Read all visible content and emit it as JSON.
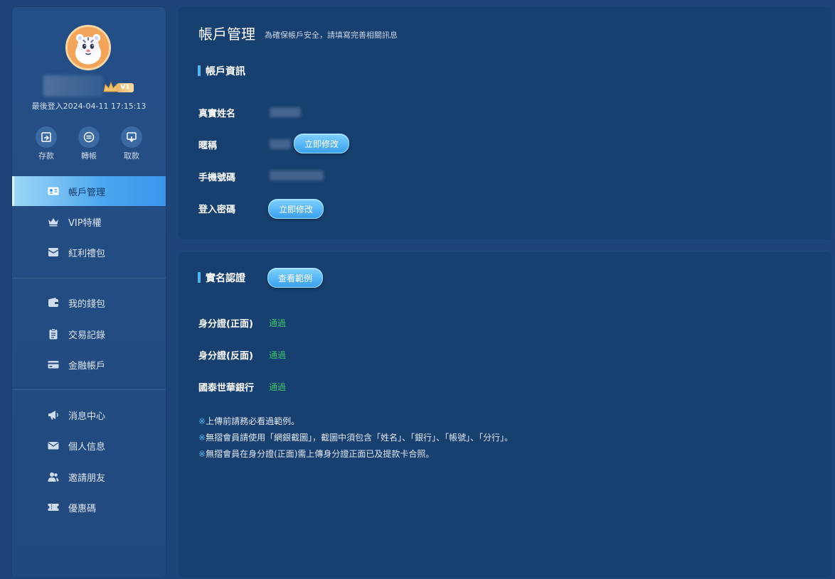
{
  "profile": {
    "last_login_label": "最後登入2024-04-11 17:15:13",
    "vip_level": "V1"
  },
  "quick_actions": [
    {
      "label": "存款",
      "icon": "deposit-icon"
    },
    {
      "label": "轉帳",
      "icon": "transfer-icon"
    },
    {
      "label": "取款",
      "icon": "withdraw-icon"
    }
  ],
  "nav": {
    "group1": [
      {
        "label": "帳戶管理",
        "icon": "id-card-icon",
        "active": true
      },
      {
        "label": "VIP特權",
        "icon": "crown-icon"
      },
      {
        "label": "紅利禮包",
        "icon": "envelope-gift-icon"
      }
    ],
    "group2": [
      {
        "label": "我的錢包",
        "icon": "wallet-icon"
      },
      {
        "label": "交易記錄",
        "icon": "clipboard-icon"
      },
      {
        "label": "金融帳戶",
        "icon": "card-icon"
      }
    ],
    "group3": [
      {
        "label": "消息中心",
        "icon": "megaphone-icon"
      },
      {
        "label": "個人信息",
        "icon": "mail-icon"
      },
      {
        "label": "邀請朋友",
        "icon": "users-icon"
      },
      {
        "label": "優惠碼",
        "icon": "ticket-icon"
      }
    ]
  },
  "page": {
    "title": "帳戶管理",
    "subtitle": "為確保帳戶安全，請填寫完善相關訊息"
  },
  "account_info": {
    "title": "帳戶資訊",
    "rows": [
      {
        "label": "真實姓名"
      },
      {
        "label": "暱稱",
        "button": "立即修改"
      },
      {
        "label": "手機號碼"
      },
      {
        "label": "登入密碼",
        "button": "立即修改"
      }
    ]
  },
  "verification": {
    "title": "實名認證",
    "example_button": "查看範例",
    "rows": [
      {
        "label": "身分證(正面)",
        "status": "通過"
      },
      {
        "label": "身分證(反面)",
        "status": "通過"
      },
      {
        "label": "國泰世華銀行",
        "status": "通過"
      }
    ],
    "notes": [
      "上傳前請務必看過範例。",
      "無摺會員請使用「網銀截圖」，截圖中須包含「姓名」、「銀行」、「帳號」、「分行」。",
      "無摺會員在身分證(正面)需上傳身分證正面已及提款卡合照。"
    ],
    "note_mark": "※"
  },
  "colors": {
    "background": "#1e4478",
    "panel": "#173f6f",
    "accent": "#4fb6f0",
    "success": "#35c06b"
  }
}
